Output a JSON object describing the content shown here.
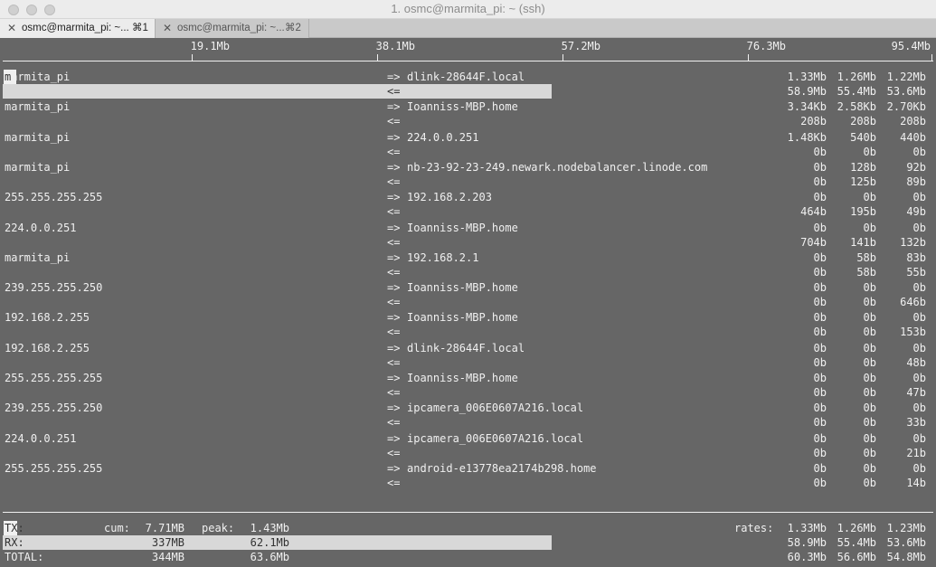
{
  "window": {
    "title": "1. osmc@marmita_pi: ~ (ssh)"
  },
  "tabs": [
    {
      "label": "osmc@marmita_pi: ~...",
      "shortcut": "⌘1",
      "active": true
    },
    {
      "label": "osmc@marmita_pi: ~...",
      "shortcut": "⌘2",
      "active": false
    }
  ],
  "scale": [
    "19.1Mb",
    "38.1Mb",
    "57.2Mb",
    "76.3Mb",
    "95.4Mb"
  ],
  "connections": [
    {
      "src": "marmita_pi",
      "dst": "dlink-28644F.local",
      "out": [
        "1.33Mb",
        "1.26Mb",
        "1.22Mb"
      ],
      "in": [
        "58.9Mb",
        "55.4Mb",
        "53.6Mb"
      ],
      "rx_bar": 0.59
    },
    {
      "src": "marmita_pi",
      "dst": "Ioanniss-MBP.home",
      "out": [
        "3.34Kb",
        "2.58Kb",
        "2.70Kb"
      ],
      "in": [
        "208b",
        "208b",
        "208b"
      ]
    },
    {
      "src": "marmita_pi",
      "dst": "224.0.0.251",
      "out": [
        "1.48Kb",
        "540b",
        "440b"
      ],
      "in": [
        "0b",
        "0b",
        "0b"
      ]
    },
    {
      "src": "marmita_pi",
      "dst": "nb-23-92-23-249.newark.nodebalancer.linode.com",
      "out": [
        "0b",
        "128b",
        "92b"
      ],
      "in": [
        "0b",
        "125b",
        "89b"
      ]
    },
    {
      "src": "255.255.255.255",
      "dst": "192.168.2.203",
      "out": [
        "0b",
        "0b",
        "0b"
      ],
      "in": [
        "464b",
        "195b",
        "49b"
      ]
    },
    {
      "src": "224.0.0.251",
      "dst": "Ioanniss-MBP.home",
      "out": [
        "0b",
        "0b",
        "0b"
      ],
      "in": [
        "704b",
        "141b",
        "132b"
      ]
    },
    {
      "src": "marmita_pi",
      "dst": "192.168.2.1",
      "out": [
        "0b",
        "58b",
        "83b"
      ],
      "in": [
        "0b",
        "58b",
        "55b"
      ]
    },
    {
      "src": "239.255.255.250",
      "dst": "Ioanniss-MBP.home",
      "out": [
        "0b",
        "0b",
        "0b"
      ],
      "in": [
        "0b",
        "0b",
        "646b"
      ]
    },
    {
      "src": "192.168.2.255",
      "dst": "Ioanniss-MBP.home",
      "out": [
        "0b",
        "0b",
        "0b"
      ],
      "in": [
        "0b",
        "0b",
        "153b"
      ]
    },
    {
      "src": "192.168.2.255",
      "dst": "dlink-28644F.local",
      "out": [
        "0b",
        "0b",
        "0b"
      ],
      "in": [
        "0b",
        "0b",
        "48b"
      ]
    },
    {
      "src": "255.255.255.255",
      "dst": "Ioanniss-MBP.home",
      "out": [
        "0b",
        "0b",
        "0b"
      ],
      "in": [
        "0b",
        "0b",
        "47b"
      ]
    },
    {
      "src": "239.255.255.250",
      "dst": "ipcamera_006E0607A216.local",
      "out": [
        "0b",
        "0b",
        "0b"
      ],
      "in": [
        "0b",
        "0b",
        "33b"
      ]
    },
    {
      "src": "224.0.0.251",
      "dst": "ipcamera_006E0607A216.local",
      "out": [
        "0b",
        "0b",
        "0b"
      ],
      "in": [
        "0b",
        "0b",
        "21b"
      ]
    },
    {
      "src": "255.255.255.255",
      "dst": "android-e13778ea2174b298.home",
      "out": [
        "0b",
        "0b",
        "0b"
      ],
      "in": [
        "0b",
        "0b",
        "14b"
      ]
    }
  ],
  "arrows": {
    "out": "=>",
    "in": "<="
  },
  "footer": {
    "tx": {
      "label": "TX:",
      "cum_label": "cum:",
      "cum": "7.71MB",
      "peak_label": "peak:",
      "peak": "1.43Mb",
      "rates_label": "rates:",
      "rates": [
        "1.33Mb",
        "1.26Mb",
        "1.23Mb"
      ]
    },
    "rx": {
      "label": "RX:",
      "cum": "337MB",
      "peak": "62.1Mb",
      "rates": [
        "58.9Mb",
        "55.4Mb",
        "53.6Mb"
      ],
      "rx_bar": 0.59
    },
    "total": {
      "label": "TOTAL:",
      "cum": "344MB",
      "peak": "63.6Mb",
      "rates": [
        "60.3Mb",
        "56.6Mb",
        "54.8Mb"
      ]
    }
  }
}
